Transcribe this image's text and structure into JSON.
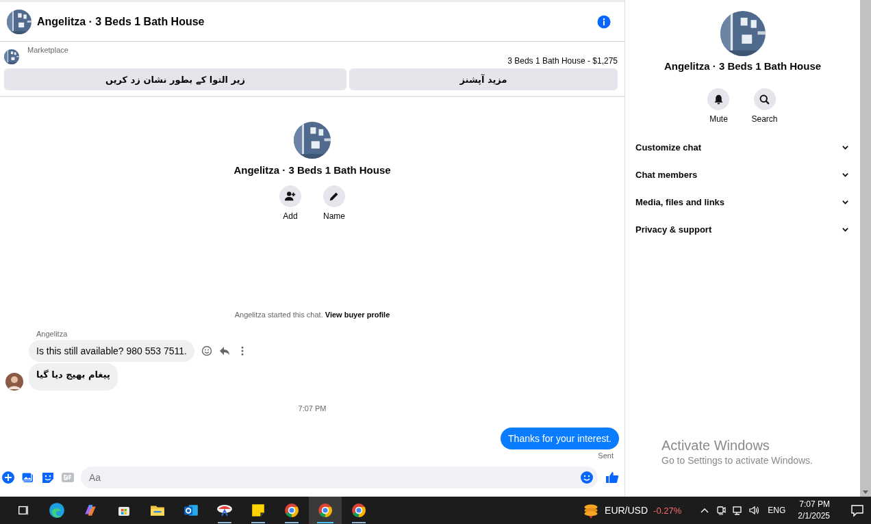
{
  "header": {
    "title": "Angelitza · 3 Beds 1 Bath House"
  },
  "listing": {
    "source": "Marketplace",
    "title": "3 Beds 1 Bath House - $1,275",
    "buttons": [
      {
        "label": "مزید آپشنز"
      },
      {
        "label": "زیر التوا کے بطور نشان زد کریں"
      }
    ]
  },
  "chat_profile": {
    "name": "Angelitza · 3 Beds 1 Bath House",
    "actions": [
      {
        "kind": "add",
        "label": "Add"
      },
      {
        "kind": "name",
        "label": "Name"
      }
    ]
  },
  "chat": {
    "notice": "Angelitza started this chat.",
    "notice_link": "View buyer profile",
    "sender": "Angelitza",
    "messages": [
      {
        "kind": "incoming",
        "text": "Is this still available? 980 553 7511."
      },
      {
        "kind": "incoming",
        "text": "پیغام بھیج دیا گیا"
      },
      {
        "kind": "time",
        "text": "7:07 PM"
      },
      {
        "kind": "outgoing",
        "text": "Thanks for your interest."
      }
    ],
    "status": "Sent"
  },
  "composer": {
    "placeholder": "Aa"
  },
  "side_panel": {
    "name": "Angelitza · 3 Beds 1 Bath House",
    "actions": [
      {
        "kind": "mute",
        "label": "Mute"
      },
      {
        "kind": "search",
        "label": "Search"
      }
    ],
    "sections": [
      {
        "label": "Customize chat",
        "expanded": false
      },
      {
        "label": "Chat members",
        "expanded": false
      },
      {
        "label": "Media, files and links",
        "expanded": false
      },
      {
        "label": "Privacy & support",
        "expanded": false
      }
    ]
  },
  "activation": {
    "title": "Activate Windows",
    "subtitle": "Go to Settings to activate Windows."
  },
  "taskbar": {
    "apps": [
      {
        "kind": "taskview",
        "running": false,
        "selected": false
      },
      {
        "kind": "edge",
        "running": false,
        "selected": false
      },
      {
        "kind": "copilot",
        "running": false,
        "selected": false
      },
      {
        "kind": "store",
        "running": false,
        "selected": false
      },
      {
        "kind": "files",
        "running": false,
        "selected": false
      },
      {
        "kind": "outlook",
        "running": false,
        "selected": false
      },
      {
        "kind": "paint",
        "running": true,
        "selected": false
      },
      {
        "kind": "notes",
        "running": true,
        "selected": false
      },
      {
        "kind": "chrome",
        "running": true,
        "selected": false
      },
      {
        "kind": "chrome",
        "running": true,
        "selected": true
      },
      {
        "kind": "chrome",
        "running": true,
        "selected": false
      }
    ],
    "ticker": {
      "name": "EUR/USD",
      "change": "-0.27%"
    },
    "language": "ENG",
    "time": "7:07 PM",
    "date": "2/1/2025"
  }
}
